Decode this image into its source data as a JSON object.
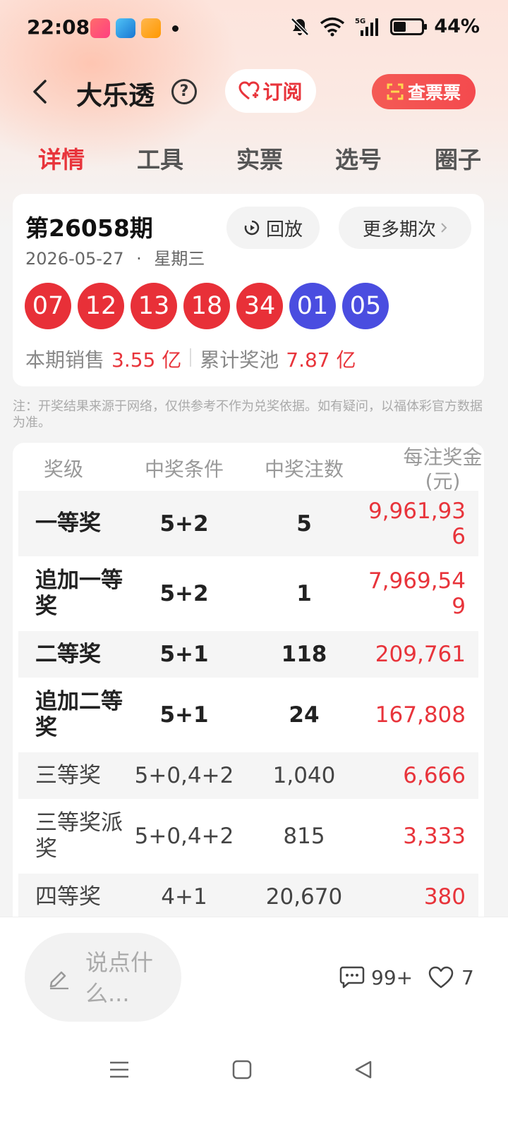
{
  "status_bar": {
    "time": "22:08",
    "battery_percent": "44%",
    "battery_level": 0.44,
    "network": "5G"
  },
  "header": {
    "title": "大乐透",
    "subscribe_label": "订阅",
    "check_ticket_label": "查票票"
  },
  "tabs": [
    {
      "label": "详情",
      "active": true
    },
    {
      "label": "工具",
      "active": false
    },
    {
      "label": "实票",
      "active": false
    },
    {
      "label": "选号",
      "active": false
    },
    {
      "label": "圈子",
      "active": false
    }
  ],
  "draw": {
    "issue": "第26058期",
    "date": "2026-05-27",
    "weekday": "星期三",
    "date_separator": "·",
    "replay_label": "回放",
    "more_label": "更多期次",
    "red_balls": [
      "07",
      "12",
      "13",
      "18",
      "34"
    ],
    "blue_balls": [
      "01",
      "05"
    ],
    "sales_label": "本期销售",
    "sales_value": "3.55 亿",
    "pool_label": "累计奖池",
    "pool_value": "7.87 亿"
  },
  "notice": "注：开奖结果来源于网络，仅供参考不作为兑奖依据。如有疑问，以福体彩官方数据为准。",
  "prize_table": {
    "headers": {
      "level": "奖级",
      "condition": "中奖条件",
      "count": "中奖注数",
      "amount": "每注奖金(元)"
    },
    "rows": [
      {
        "level": "一等奖",
        "condition": "5+2",
        "count": "5",
        "amount": "9,961,936"
      },
      {
        "level": "追加一等奖",
        "condition": "5+2",
        "count": "1",
        "amount": "7,969,549"
      },
      {
        "level": "二等奖",
        "condition": "5+1",
        "count": "118",
        "amount": "209,761"
      },
      {
        "level": "追加二等奖",
        "condition": "5+1",
        "count": "24",
        "amount": "167,808"
      },
      {
        "level": "三等奖",
        "condition": "5+0,4+2",
        "count": "1,040",
        "amount": "6,666"
      },
      {
        "level": "三等奖派奖",
        "condition": "5+0,4+2",
        "count": "815",
        "amount": "3,333"
      },
      {
        "level": "四等奖",
        "condition": "4+1",
        "count": "20,670",
        "amount": "380"
      }
    ]
  },
  "bottom": {
    "comment_placeholder": "说点什么...",
    "comment_count": "99+",
    "like_count": "7"
  },
  "colors": {
    "accent_red": "#e8343b",
    "ball_red": "#e83038",
    "ball_blue": "#4a4de0"
  }
}
